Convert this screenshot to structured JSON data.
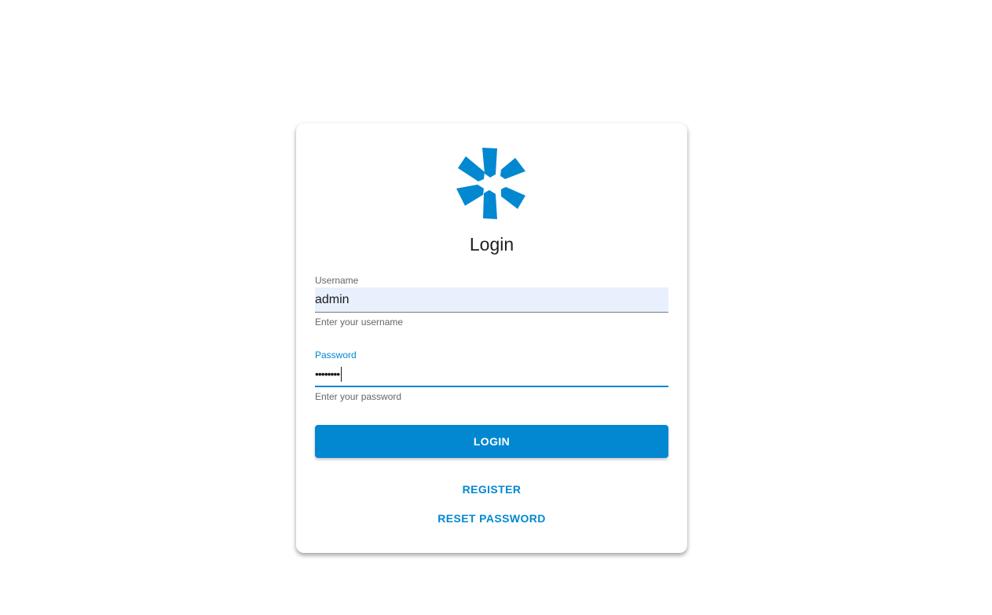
{
  "login": {
    "title": "Login",
    "brand_color": "#0288d1",
    "logo_icon": "asterisk-logo-icon",
    "username": {
      "label": "Username",
      "value": "admin",
      "hint": "Enter your username"
    },
    "password": {
      "label": "Password",
      "masked_value": "••••••••",
      "hint": "Enter your password"
    },
    "login_button_label": "LOGIN",
    "register_label": "REGISTER",
    "reset_password_label": "RESET PASSWORD"
  }
}
